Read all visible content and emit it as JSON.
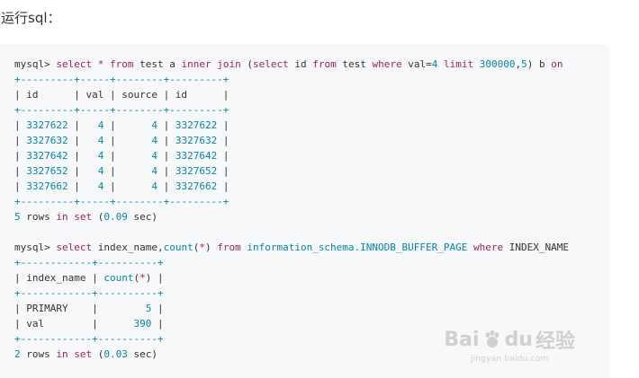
{
  "heading": "运行sql：",
  "code_lines": [
    [
      {
        "t": "mysql> ",
        "c": ""
      },
      {
        "t": "select",
        "c": "k"
      },
      {
        "t": " ",
        "c": ""
      },
      {
        "t": "*",
        "c": "o"
      },
      {
        "t": " ",
        "c": ""
      },
      {
        "t": "from",
        "c": "k"
      },
      {
        "t": " test a ",
        "c": ""
      },
      {
        "t": "inner",
        "c": "k"
      },
      {
        "t": " ",
        "c": ""
      },
      {
        "t": "join",
        "c": "k"
      },
      {
        "t": " (",
        "c": ""
      },
      {
        "t": "select",
        "c": "k"
      },
      {
        "t": " id ",
        "c": ""
      },
      {
        "t": "from",
        "c": "k"
      },
      {
        "t": " test ",
        "c": ""
      },
      {
        "t": "where",
        "c": "k"
      },
      {
        "t": " val=",
        "c": ""
      },
      {
        "t": "4",
        "c": "n"
      },
      {
        "t": " ",
        "c": ""
      },
      {
        "t": "limit",
        "c": "k"
      },
      {
        "t": " ",
        "c": ""
      },
      {
        "t": "300000",
        "c": "n"
      },
      {
        "t": ",",
        "c": ""
      },
      {
        "t": "5",
        "c": "n"
      },
      {
        "t": ") b ",
        "c": ""
      },
      {
        "t": "on",
        "c": "k"
      }
    ],
    [
      {
        "t": "+---------+-----+--------+---------+",
        "c": "b"
      }
    ],
    [
      {
        "t": "| id      | val | source | id      |",
        "c": ""
      }
    ],
    [
      {
        "t": "+---------+-----+--------+---------+",
        "c": "b"
      }
    ],
    [
      {
        "t": "| ",
        "c": ""
      },
      {
        "t": "3327622",
        "c": "n"
      },
      {
        "t": " |   ",
        "c": ""
      },
      {
        "t": "4",
        "c": "n"
      },
      {
        "t": " |      ",
        "c": ""
      },
      {
        "t": "4",
        "c": "n"
      },
      {
        "t": " | ",
        "c": ""
      },
      {
        "t": "3327622",
        "c": "n"
      },
      {
        "t": " |",
        "c": ""
      }
    ],
    [
      {
        "t": "| ",
        "c": ""
      },
      {
        "t": "3327632",
        "c": "n"
      },
      {
        "t": " |   ",
        "c": ""
      },
      {
        "t": "4",
        "c": "n"
      },
      {
        "t": " |      ",
        "c": ""
      },
      {
        "t": "4",
        "c": "n"
      },
      {
        "t": " | ",
        "c": ""
      },
      {
        "t": "3327632",
        "c": "n"
      },
      {
        "t": " |",
        "c": ""
      }
    ],
    [
      {
        "t": "| ",
        "c": ""
      },
      {
        "t": "3327642",
        "c": "n"
      },
      {
        "t": " |   ",
        "c": ""
      },
      {
        "t": "4",
        "c": "n"
      },
      {
        "t": " |      ",
        "c": ""
      },
      {
        "t": "4",
        "c": "n"
      },
      {
        "t": " | ",
        "c": ""
      },
      {
        "t": "3327642",
        "c": "n"
      },
      {
        "t": " |",
        "c": ""
      }
    ],
    [
      {
        "t": "| ",
        "c": ""
      },
      {
        "t": "3327652",
        "c": "n"
      },
      {
        "t": " |   ",
        "c": ""
      },
      {
        "t": "4",
        "c": "n"
      },
      {
        "t": " |      ",
        "c": ""
      },
      {
        "t": "4",
        "c": "n"
      },
      {
        "t": " | ",
        "c": ""
      },
      {
        "t": "3327652",
        "c": "n"
      },
      {
        "t": " |",
        "c": ""
      }
    ],
    [
      {
        "t": "| ",
        "c": ""
      },
      {
        "t": "3327662",
        "c": "n"
      },
      {
        "t": " |   ",
        "c": ""
      },
      {
        "t": "4",
        "c": "n"
      },
      {
        "t": " |      ",
        "c": ""
      },
      {
        "t": "4",
        "c": "n"
      },
      {
        "t": " | ",
        "c": ""
      },
      {
        "t": "3327662",
        "c": "n"
      },
      {
        "t": " |",
        "c": ""
      }
    ],
    [
      {
        "t": "+---------+-----+--------+---------+",
        "c": "b"
      }
    ],
    [
      {
        "t": "5",
        "c": "n"
      },
      {
        "t": " rows ",
        "c": ""
      },
      {
        "t": "in",
        "c": "k"
      },
      {
        "t": " ",
        "c": ""
      },
      {
        "t": "set",
        "c": "k"
      },
      {
        "t": " (",
        "c": ""
      },
      {
        "t": "0.09",
        "c": "n"
      },
      {
        "t": " sec)",
        "c": ""
      }
    ],
    [
      {
        "t": "",
        "c": ""
      }
    ],
    [
      {
        "t": "mysql> ",
        "c": ""
      },
      {
        "t": "select",
        "c": "k"
      },
      {
        "t": " index_name,",
        "c": ""
      },
      {
        "t": "count",
        "c": "n"
      },
      {
        "t": "(",
        "c": ""
      },
      {
        "t": "*",
        "c": "o"
      },
      {
        "t": ") ",
        "c": ""
      },
      {
        "t": "from",
        "c": "k"
      },
      {
        "t": " ",
        "c": ""
      },
      {
        "t": "information_schema.INNODB_BUFFER_PAGE",
        "c": "n"
      },
      {
        "t": " ",
        "c": ""
      },
      {
        "t": "where",
        "c": "k"
      },
      {
        "t": " INDEX_NAME",
        "c": ""
      }
    ],
    [
      {
        "t": "+------------+----------+",
        "c": "b"
      }
    ],
    [
      {
        "t": "| index_name | ",
        "c": ""
      },
      {
        "t": "count",
        "c": "n"
      },
      {
        "t": "(",
        "c": ""
      },
      {
        "t": "*",
        "c": "o"
      },
      {
        "t": ") |",
        "c": ""
      }
    ],
    [
      {
        "t": "+------------+----------+",
        "c": "b"
      }
    ],
    [
      {
        "t": "| PRIMARY    |        ",
        "c": ""
      },
      {
        "t": "5",
        "c": "n"
      },
      {
        "t": " |",
        "c": ""
      }
    ],
    [
      {
        "t": "| val        |      ",
        "c": ""
      },
      {
        "t": "390",
        "c": "n"
      },
      {
        "t": " |",
        "c": ""
      }
    ],
    [
      {
        "t": "+------------+----------+",
        "c": "b"
      }
    ],
    [
      {
        "t": "2",
        "c": "n"
      },
      {
        "t": " rows ",
        "c": ""
      },
      {
        "t": "in",
        "c": "k"
      },
      {
        "t": " ",
        "c": ""
      },
      {
        "t": "set",
        "c": "k"
      },
      {
        "t": " (",
        "c": ""
      },
      {
        "t": "0.03",
        "c": "n"
      },
      {
        "t": " sec)",
        "c": ""
      }
    ]
  ],
  "watermark": {
    "brand_left": "Bai",
    "brand_right": "du",
    "brand_cn": "经验",
    "url": "jingyan.baidu.com"
  },
  "colors": {
    "keyword": "#a71d5d",
    "number": "#0086b3",
    "text": "#333333",
    "code_bg": "#f6f8fa"
  }
}
